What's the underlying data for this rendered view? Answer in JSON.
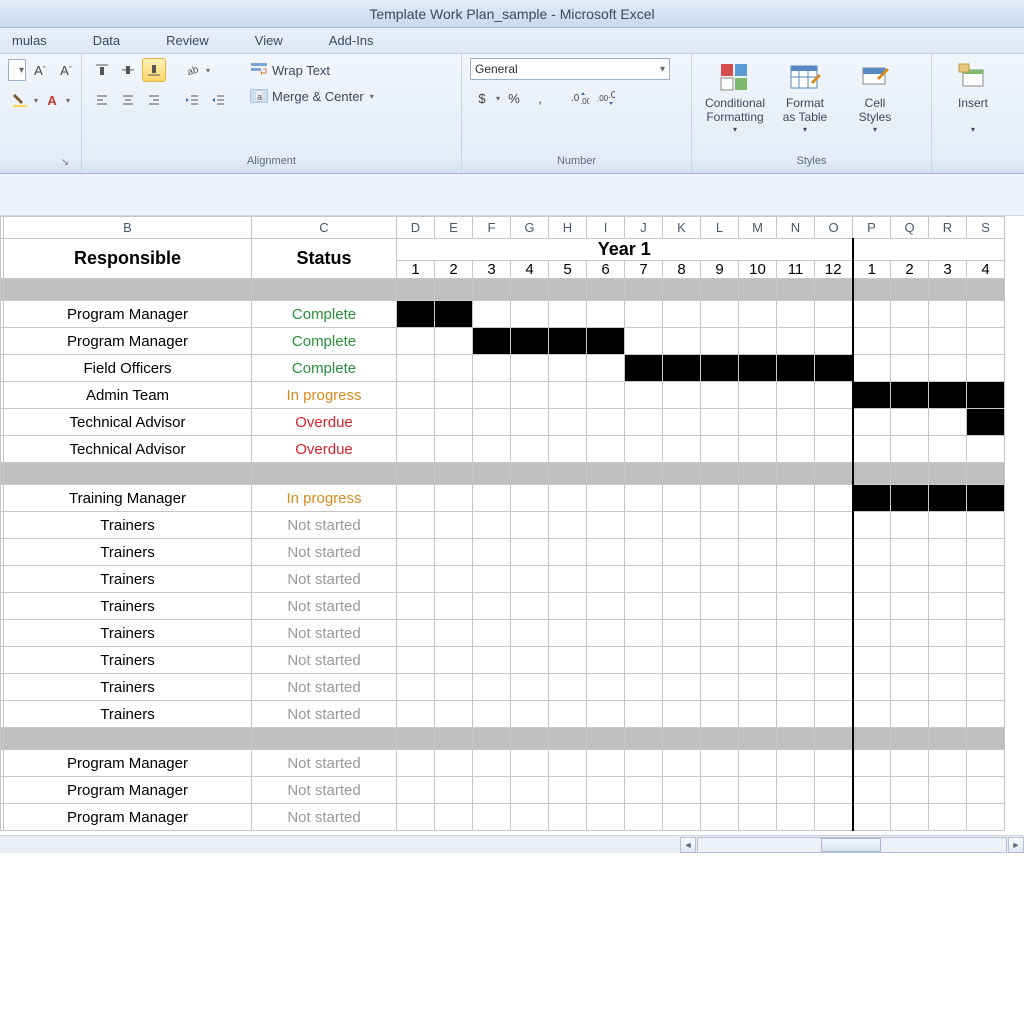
{
  "title": "Template Work Plan_sample  -  Microsoft Excel",
  "ribbon_tabs": [
    "mulas",
    "Data",
    "Review",
    "View",
    "Add-Ins"
  ],
  "groups": {
    "alignment": "Alignment",
    "number": "Number",
    "styles": "Styles"
  },
  "ribbon": {
    "wrap_text": "Wrap Text",
    "merge_center": "Merge & Center",
    "number_format": "General",
    "cond_fmt": "Conditional\nFormatting",
    "format_table": "Format\nas Table",
    "cell_styles": "Cell\nStyles",
    "insert": "Insert"
  },
  "columns": [
    "B",
    "C",
    "D",
    "E",
    "F",
    "G",
    "H",
    "I",
    "J",
    "K",
    "L",
    "M",
    "N",
    "O",
    "P",
    "Q",
    "R",
    "S"
  ],
  "headers": {
    "responsible": "Responsible",
    "status": "Status",
    "year1": "Year 1"
  },
  "months_y1": [
    "1",
    "2",
    "3",
    "4",
    "5",
    "6",
    "7",
    "8",
    "9",
    "10",
    "11",
    "12"
  ],
  "months_y2": [
    "1",
    "2",
    "3",
    "4"
  ],
  "rows": [
    {
      "resp": "Program Manager",
      "status": "Complete",
      "status_cls": "complete",
      "bars": [
        0,
        1
      ]
    },
    {
      "resp": "Program Manager",
      "status": "Complete",
      "status_cls": "complete",
      "bars": [
        2,
        3,
        4,
        5
      ]
    },
    {
      "resp": "Field Officers",
      "status": "Complete",
      "status_cls": "complete",
      "bars": [
        6,
        7,
        8,
        9,
        10,
        11
      ]
    },
    {
      "resp": "Admin Team",
      "status": "In progress",
      "status_cls": "progress",
      "bars": [
        12,
        13,
        14,
        15
      ]
    },
    {
      "resp": "Technical Advisor",
      "status": "Overdue",
      "status_cls": "overdue",
      "bars": [
        15
      ]
    },
    {
      "resp": "Technical Advisor",
      "status": "Overdue",
      "status_cls": "overdue",
      "bars": []
    }
  ],
  "rows2": [
    {
      "resp": "Training Manager",
      "status": "In progress",
      "status_cls": "progress",
      "bars": [
        12,
        13,
        14,
        15
      ]
    },
    {
      "resp": "Trainers",
      "status": "Not started",
      "status_cls": "notstarted",
      "bars": []
    },
    {
      "resp": "Trainers",
      "status": "Not started",
      "status_cls": "notstarted",
      "bars": []
    },
    {
      "resp": "Trainers",
      "status": "Not started",
      "status_cls": "notstarted",
      "bars": []
    },
    {
      "resp": "Trainers",
      "status": "Not started",
      "status_cls": "notstarted",
      "bars": []
    },
    {
      "resp": "Trainers",
      "status": "Not started",
      "status_cls": "notstarted",
      "bars": []
    },
    {
      "resp": "Trainers",
      "status": "Not started",
      "status_cls": "notstarted",
      "bars": []
    },
    {
      "resp": "Trainers",
      "status": "Not started",
      "status_cls": "notstarted",
      "bars": []
    },
    {
      "resp": "Trainers",
      "status": "Not started",
      "status_cls": "notstarted",
      "bars": []
    }
  ],
  "rows3": [
    {
      "resp": "Program Manager",
      "status": "Not started",
      "status_cls": "notstarted",
      "bars": []
    },
    {
      "resp": "Program Manager",
      "status": "Not started",
      "status_cls": "notstarted",
      "bars": []
    },
    {
      "resp": "Program Manager",
      "status": "Not started",
      "status_cls": "notstarted",
      "bars": []
    }
  ]
}
